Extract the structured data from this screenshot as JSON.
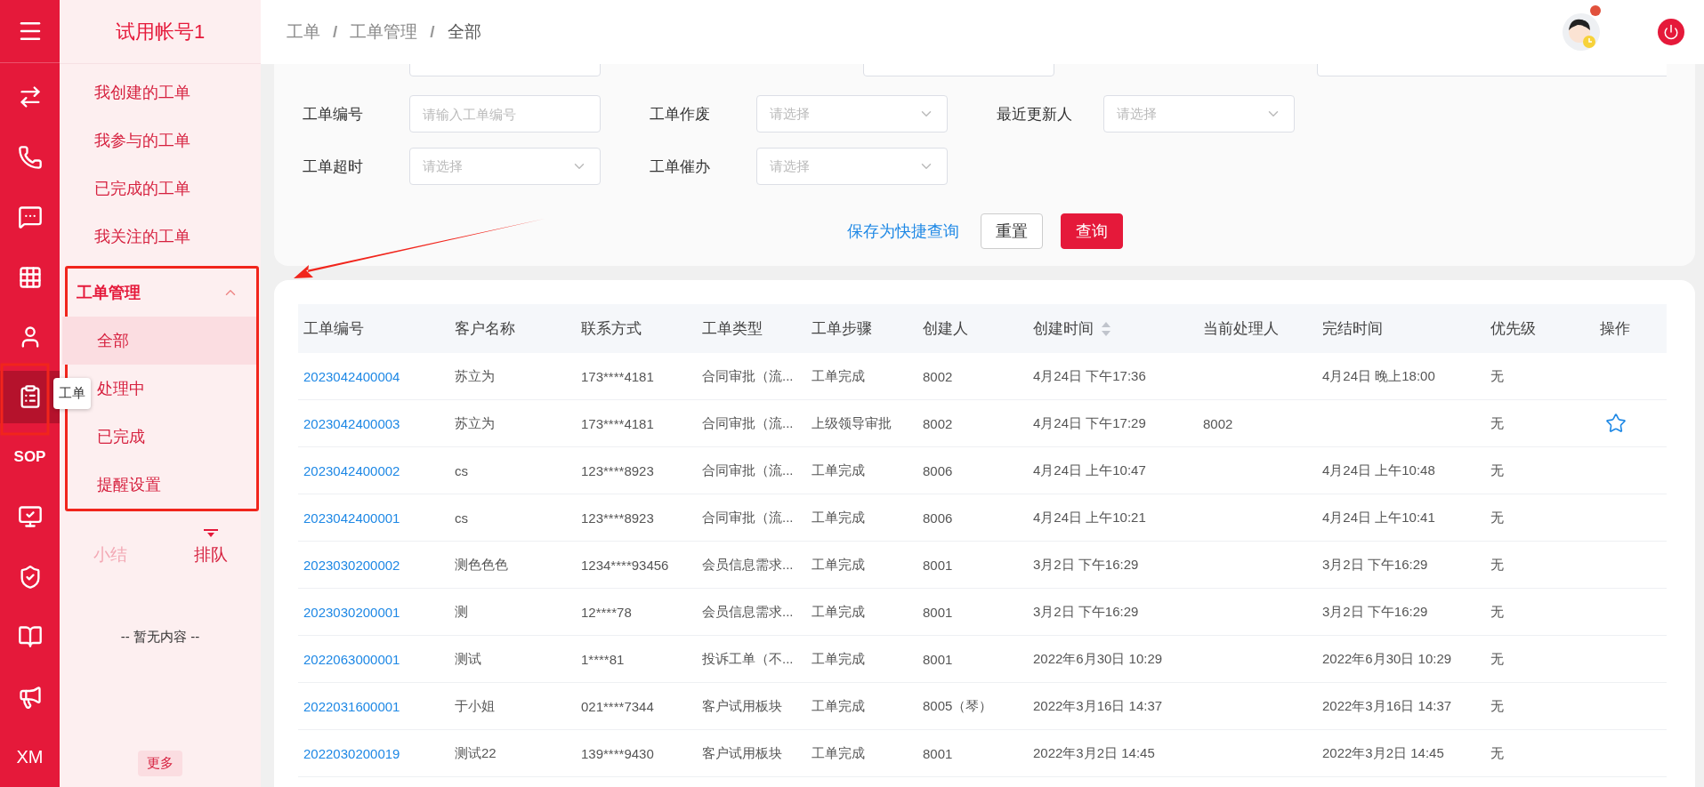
{
  "rail": {
    "items": [
      {
        "selected": false
      },
      {
        "selected": false
      },
      {
        "selected": false
      },
      {
        "selected": false
      },
      {
        "selected": false
      },
      {
        "selected": true
      },
      {
        "label": "SOP",
        "selected": false
      },
      {
        "selected": false
      },
      {
        "selected": false
      },
      {
        "selected": false
      },
      {
        "selected": false
      },
      {
        "label": "XM",
        "selected": false
      }
    ],
    "tooltip": "工单"
  },
  "sidebar": {
    "title": "试用帐号1",
    "items": [
      {
        "label": "我创建的工单",
        "selected": false
      },
      {
        "label": "我参与的工单",
        "selected": false
      },
      {
        "label": "已完成的工单",
        "selected": false
      },
      {
        "label": "我关注的工单",
        "selected": false
      }
    ],
    "group": {
      "title": "工单管理",
      "expanded": true,
      "children": [
        {
          "label": "全部",
          "selected": true
        },
        {
          "label": "处理中",
          "selected": false
        },
        {
          "label": "已完成",
          "selected": false
        },
        {
          "label": "提醒设置",
          "selected": false
        }
      ]
    },
    "queue_tabs": [
      {
        "label": "小结",
        "selected": false
      },
      {
        "label": "排队",
        "selected": true
      }
    ],
    "empty_text": "-- 暂无内容 --",
    "more_button": "更多"
  },
  "header": {
    "breadcrumb": [
      {
        "kind": "link",
        "text": "工单"
      },
      {
        "kind": "separator",
        "text": "/"
      },
      {
        "kind": "link",
        "text": "工单管理"
      },
      {
        "kind": "separator",
        "text": "/"
      },
      {
        "kind": "current",
        "text": "全部"
      }
    ],
    "avatar_badge": true
  },
  "filters": {
    "partial_row": [
      {
        "kind": "input"
      },
      {
        "kind": "input"
      },
      {
        "kind": "date_range"
      }
    ],
    "rows": [
      [
        {
          "label": "工单编号",
          "placeholder": "请输入工单编号",
          "kind": "input"
        },
        {
          "label": "工单作废",
          "placeholder": "请选择",
          "kind": "select"
        },
        {
          "label": "最近更新人",
          "placeholder": "请选择",
          "kind": "select"
        }
      ],
      [
        {
          "label": "工单超时",
          "placeholder": "请选择",
          "kind": "select"
        },
        {
          "label": "工单催办",
          "placeholder": "请选择",
          "kind": "select"
        }
      ]
    ],
    "buttons": [
      {
        "label": "保存为快捷查询",
        "kind": "link"
      },
      {
        "label": "重置",
        "kind": "default"
      },
      {
        "label": "查询",
        "kind": "primary"
      }
    ]
  },
  "table": {
    "columns": [
      {
        "label": "工单编号",
        "sortable": false
      },
      {
        "label": "客户名称",
        "sortable": false
      },
      {
        "label": "联系方式",
        "sortable": false
      },
      {
        "label": "工单类型",
        "sortable": false
      },
      {
        "label": "工单步骤",
        "sortable": false
      },
      {
        "label": "创建人",
        "sortable": false
      },
      {
        "label": "创建时间",
        "sortable": true
      },
      {
        "label": "当前处理人",
        "sortable": false
      },
      {
        "label": "完结时间",
        "sortable": false
      },
      {
        "label": "优先级",
        "sortable": false
      },
      {
        "label": "操作",
        "sortable": false
      }
    ],
    "rows": [
      {
        "cells": [
          "2023042400004",
          "苏立为",
          "173****4181",
          "合同审批（流...",
          "工单完成",
          "8002",
          "4月24日 下午17:36",
          "",
          "4月24日 晚上18:00",
          "无"
        ],
        "starred": false
      },
      {
        "cells": [
          "2023042400003",
          "苏立为",
          "173****4181",
          "合同审批（流...",
          "上级领导审批",
          "8002",
          "4月24日 下午17:29",
          "8002",
          "",
          "无"
        ],
        "starred": true
      },
      {
        "cells": [
          "2023042400002",
          "cs",
          "123****8923",
          "合同审批（流...",
          "工单完成",
          "8006",
          "4月24日 上午10:47",
          "",
          "4月24日 上午10:48",
          "无"
        ],
        "starred": false
      },
      {
        "cells": [
          "2023042400001",
          "cs",
          "123****8923",
          "合同审批（流...",
          "工单完成",
          "8006",
          "4月24日 上午10:21",
          "",
          "4月24日 上午10:41",
          "无"
        ],
        "starred": false
      },
      {
        "cells": [
          "2023030200002",
          "测色色色",
          "1234****93456",
          "会员信息需求...",
          "工单完成",
          "8001",
          "3月2日 下午16:29",
          "",
          "3月2日 下午16:29",
          "无"
        ],
        "starred": false
      },
      {
        "cells": [
          "2023030200001",
          "测",
          "12****78",
          "会员信息需求...",
          "工单完成",
          "8001",
          "3月2日 下午16:29",
          "",
          "3月2日 下午16:29",
          "无"
        ],
        "starred": false
      },
      {
        "cells": [
          "2022063000001",
          "测试",
          "1****81",
          "投诉工单（不...",
          "工单完成",
          "8001",
          "2022年6月30日 10:29",
          "",
          "2022年6月30日 10:29",
          "无"
        ],
        "starred": false
      },
      {
        "cells": [
          "2022031600001",
          "于小姐",
          "021****7344",
          "客户试用板块",
          "工单完成",
          "8005（琴）",
          "2022年3月16日 14:37",
          "",
          "2022年3月16日 14:37",
          "无"
        ],
        "starred": false
      },
      {
        "cells": [
          "2022030200019",
          "测试22",
          "139****9430",
          "客户试用板块",
          "工单完成",
          "8001",
          "2022年3月2日 14:45",
          "",
          "2022年3月2日 14:45",
          "无"
        ],
        "starred": false
      }
    ]
  }
}
